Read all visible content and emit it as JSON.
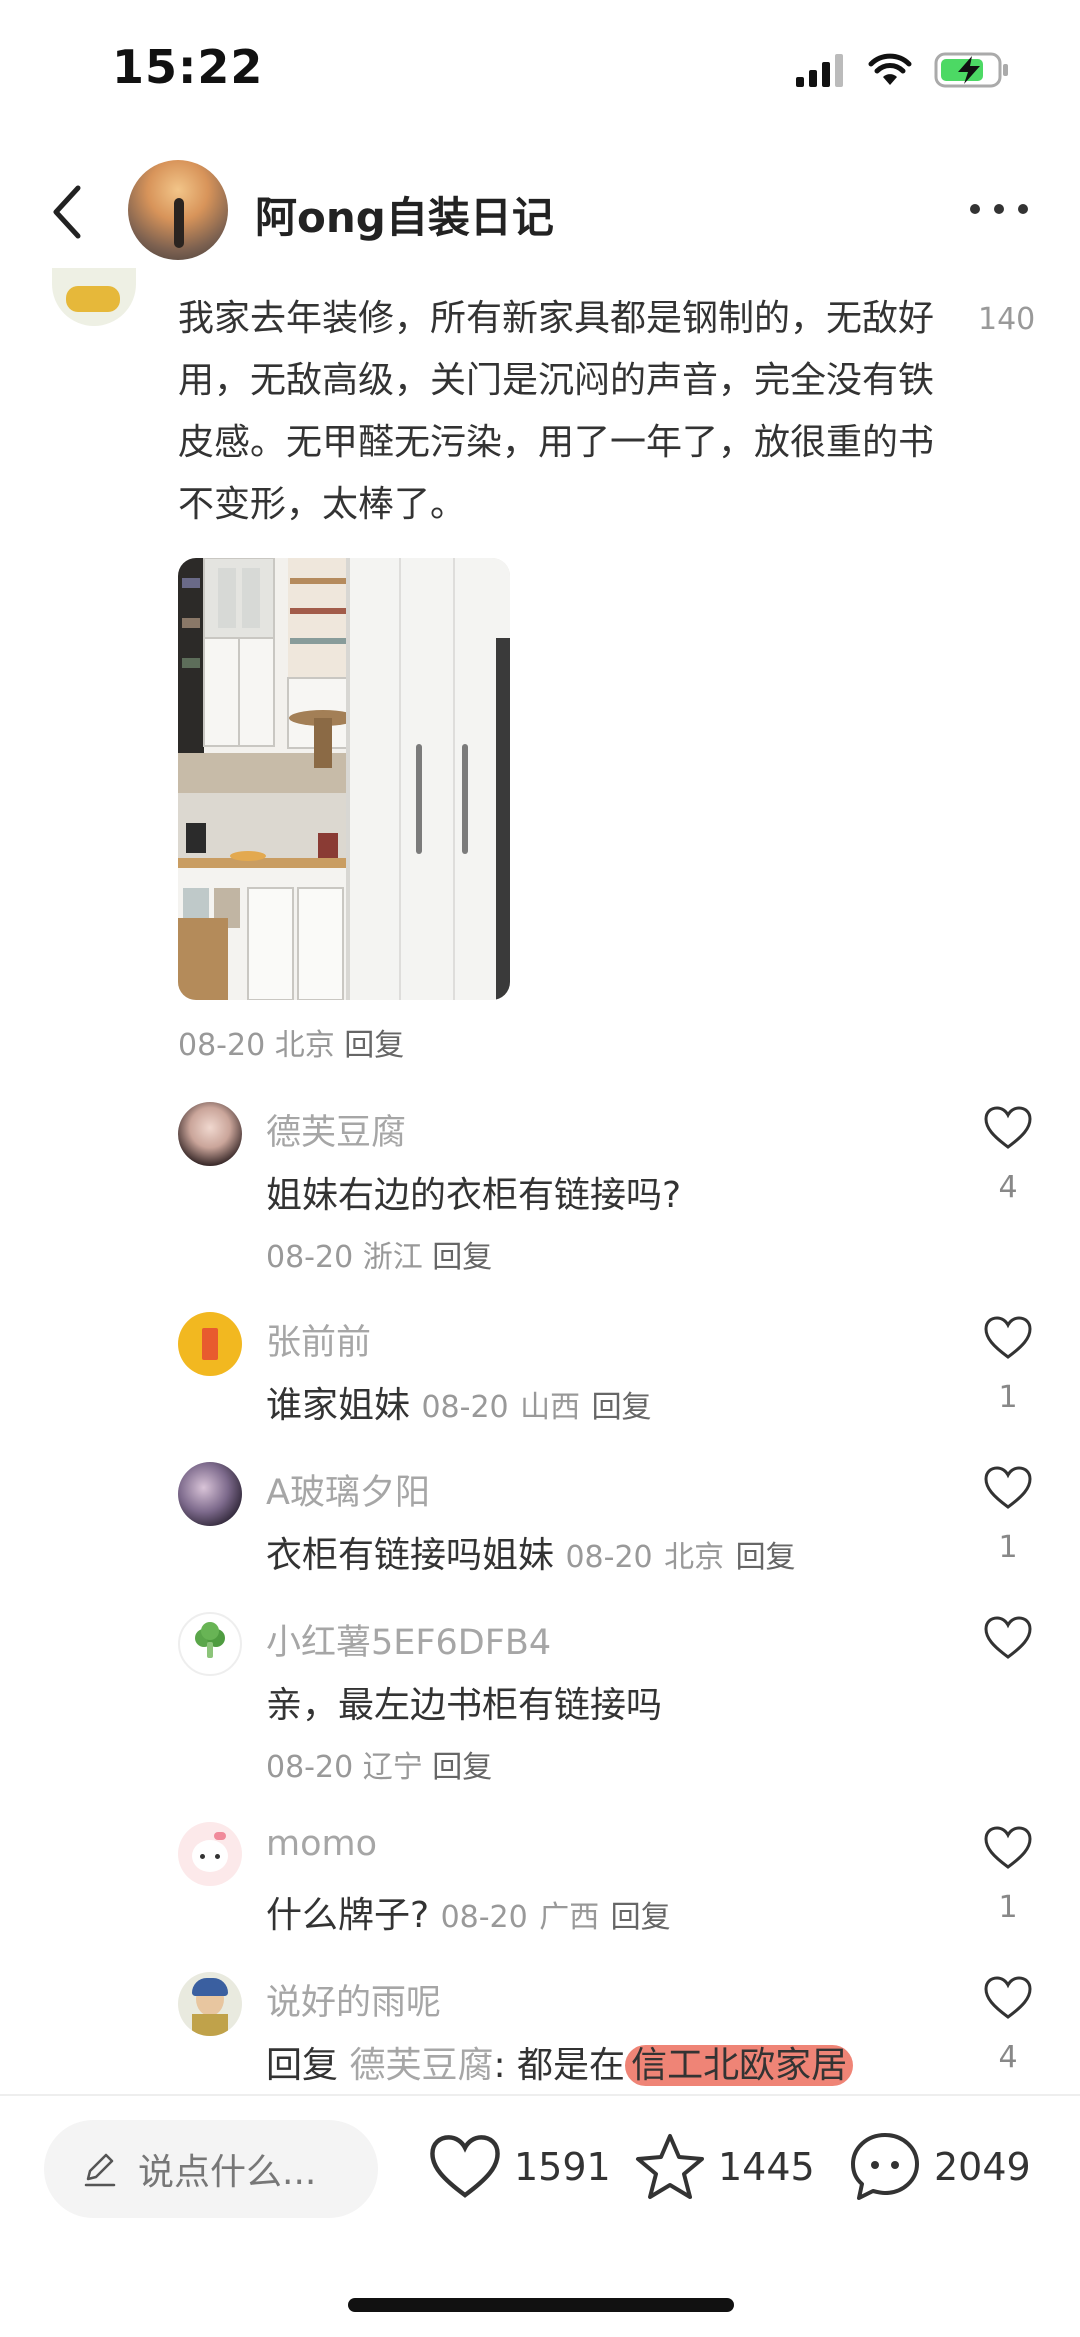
{
  "status_bar": {
    "time": "15:22"
  },
  "header": {
    "title": "阿ong自装日记"
  },
  "main_comment": {
    "text": "我家去年装修，所有新家具都是钢制的，无敌好用，无敌高级，关门是沉闷的声音，完全没有铁皮感。无甲醛无污染，用了一年了，放很重的书不变形，太棒了。",
    "likes": "140",
    "date": "08-20",
    "location": "北京",
    "reply_label": "回复"
  },
  "replies": [
    {
      "name": "德芙豆腐",
      "text": "姐妹右边的衣柜有链接吗?",
      "date": "08-20",
      "location": "浙江",
      "reply_label": "回复",
      "likes": "4"
    },
    {
      "name": "张前前",
      "text": "谁家姐妹",
      "date": "08-20",
      "location": "山西",
      "reply_label": "回复",
      "likes": "1"
    },
    {
      "name": "A玻璃夕阳",
      "text": "衣柜有链接吗姐妹",
      "date": "08-20",
      "location": "北京",
      "reply_label": "回复",
      "likes": "1"
    },
    {
      "name": "小红薯5EF6DFB4",
      "text": "亲，最左边书柜有链接吗",
      "date": "08-20",
      "location": "辽宁",
      "reply_label": "回复",
      "likes": ""
    },
    {
      "name": "momo",
      "text": "什么牌子?",
      "date": "08-20",
      "location": "广西",
      "reply_label": "回复",
      "likes": "1"
    },
    {
      "name": "说好的雨呢",
      "prefix": "回复",
      "quoted_user": "德芙豆腐",
      "text": ": 都是在",
      "highlight": "信工北欧家居",
      "likes": "4"
    }
  ],
  "bottom_bar": {
    "input_placeholder": "说点什么...",
    "like_count": "1591",
    "star_count": "1445",
    "comment_count": "2049"
  },
  "colors": {
    "highlight": "#e8503c",
    "muted": "#999999",
    "name_gray": "#a6a6a6"
  },
  "icons": [
    "back-chevron-icon",
    "more-dots-icon",
    "heart-icon",
    "star-icon",
    "comment-bubble-icon",
    "pencil-icon",
    "signal-icon",
    "wifi-icon",
    "battery-icon"
  ]
}
